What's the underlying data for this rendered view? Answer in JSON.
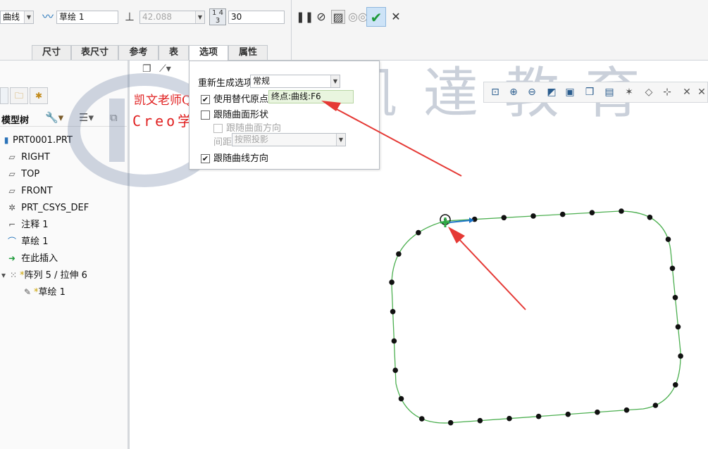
{
  "ribbon": {
    "type_value": "曲线",
    "sketch_value": "草绘 1",
    "length_value": "42.088",
    "number_value": "30",
    "pause_icon": "pause-icon",
    "no_preview_icon": "no-preview-icon",
    "verify_icon": "glasses-icon",
    "ok_icon": "check-icon",
    "cancel_icon": "close-icon",
    "tabs": [
      "尺寸",
      "表尺寸",
      "参考",
      "表",
      "选项",
      "属性"
    ],
    "active_tab": "选项"
  },
  "tree": {
    "header_label": "模型树",
    "items": [
      {
        "label": "PRT0001.PRT",
        "icon": "part-icon"
      },
      {
        "label": "RIGHT",
        "icon": "datum-plane-icon"
      },
      {
        "label": "TOP",
        "icon": "datum-plane-icon"
      },
      {
        "label": "FRONT",
        "icon": "datum-plane-icon"
      },
      {
        "label": "PRT_CSYS_DEF",
        "icon": "csys-icon"
      },
      {
        "label": "注释 1",
        "icon": "annotation-icon"
      },
      {
        "label": "草绘 1",
        "icon": "sketch-icon"
      },
      {
        "label": "在此插入",
        "icon": "insert-here-icon"
      },
      {
        "label": "阵列 5 / 拉伸 6",
        "icon": "pattern-icon"
      },
      {
        "label": "草绘 1",
        "icon": "sketch-icon"
      }
    ]
  },
  "options": {
    "regen_label": "重新生成选项",
    "regen_value": "常规",
    "use_alt_origin_label": "使用替代原点",
    "use_alt_origin_checked": true,
    "alt_origin_value": "终点:曲线:F6",
    "follow_surface_shape_label": "跟随曲面形状",
    "follow_surface_shape_checked": false,
    "follow_surface_dir_label": "跟随曲面方向",
    "spacing_label": "间距",
    "spacing_value": "按照投影",
    "follow_curve_dir_label": "跟随曲线方向",
    "follow_curve_dir_checked": true
  },
  "watermark": {
    "teacher_text": "凯文老师Q",
    "creo_text": "Creo学",
    "brand_text": "凯 達 教 育"
  },
  "colors": {
    "curve": "#4caf50",
    "points": "#111111",
    "arrow": "#e53935",
    "accent": "#1a73c8"
  },
  "point_count": 30
}
